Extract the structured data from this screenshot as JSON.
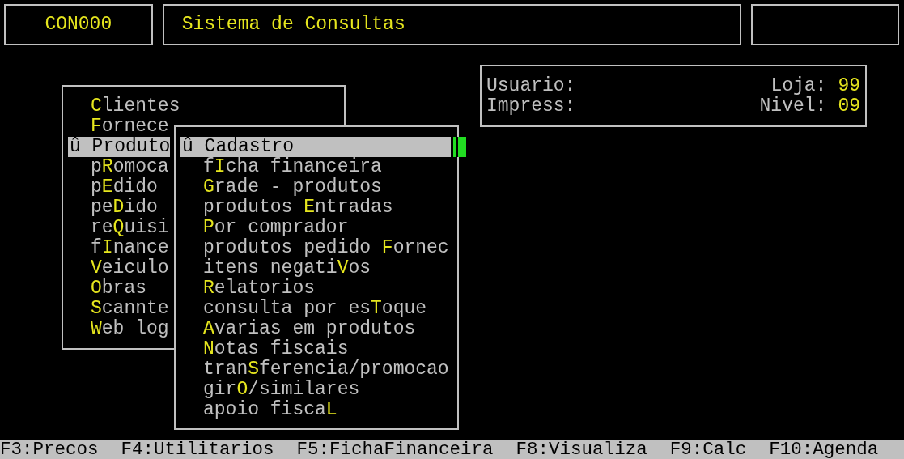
{
  "header": {
    "program_code": "CON000",
    "title": "Sistema de Consultas"
  },
  "info": {
    "usuario_label": "Usuario:",
    "loja_label": "Loja:",
    "loja_value": "99",
    "impress_label": "Impress:",
    "nivel_label": "Nivel:",
    "nivel_value": "09"
  },
  "main_menu": {
    "items": [
      {
        "key": "C",
        "after": "lientes",
        "selected": false
      },
      {
        "key": "F",
        "after": "ornece",
        "selected": false
      },
      {
        "before": "û ",
        "key": "P",
        "after": "roduto",
        "selected": true
      },
      {
        "before": "p",
        "key": "R",
        "after": "omoca",
        "selected": false
      },
      {
        "before": "p",
        "key": "E",
        "after": "dido",
        "selected": false
      },
      {
        "before": "pe",
        "key": "D",
        "after": "ido",
        "selected": false
      },
      {
        "before": "re",
        "key": "Q",
        "after": "uisi",
        "selected": false
      },
      {
        "before": "f",
        "key": "I",
        "after": "nance",
        "selected": false
      },
      {
        "key": "V",
        "after": "eiculo",
        "selected": false
      },
      {
        "key": "O",
        "after": "bras",
        "selected": false
      },
      {
        "key": "S",
        "after": "cannte",
        "selected": false
      },
      {
        "key": "W",
        "after": "eb log",
        "selected": false
      }
    ]
  },
  "submenu": {
    "items": [
      {
        "before": "û ",
        "key": "C",
        "after": "adastro",
        "selected": true
      },
      {
        "before": "f",
        "key": "I",
        "after": "cha financeira",
        "selected": false
      },
      {
        "key": "G",
        "after": "rade - produtos",
        "selected": false
      },
      {
        "before": "produtos ",
        "key": "E",
        "after": "ntradas",
        "selected": false
      },
      {
        "key": "P",
        "after": "or comprador",
        "selected": false
      },
      {
        "before": "produtos pedido ",
        "key": "F",
        "after": "ornec",
        "selected": false
      },
      {
        "before": "itens negati",
        "key": "V",
        "after": "os",
        "selected": false
      },
      {
        "key": "R",
        "after": "elatorios",
        "selected": false
      },
      {
        "before": "consulta por es",
        "key": "T",
        "after": "oque",
        "selected": false
      },
      {
        "key": "A",
        "after": "varias em produtos",
        "selected": false
      },
      {
        "key": "N",
        "after": "otas fiscais",
        "selected": false
      },
      {
        "before": "tran",
        "key": "S",
        "after": "ferencia/promocao",
        "selected": false
      },
      {
        "before": "gir",
        "key": "O",
        "after": "/similares",
        "selected": false
      },
      {
        "before": "apoio fisca",
        "key": "L",
        "selected": false
      }
    ]
  },
  "function_keys": [
    "F3:Precos",
    "F4:Utilitarios",
    "F5:FichaFinanceira",
    "F8:Visualiza",
    "F9:Calc",
    "F10:Agenda"
  ]
}
